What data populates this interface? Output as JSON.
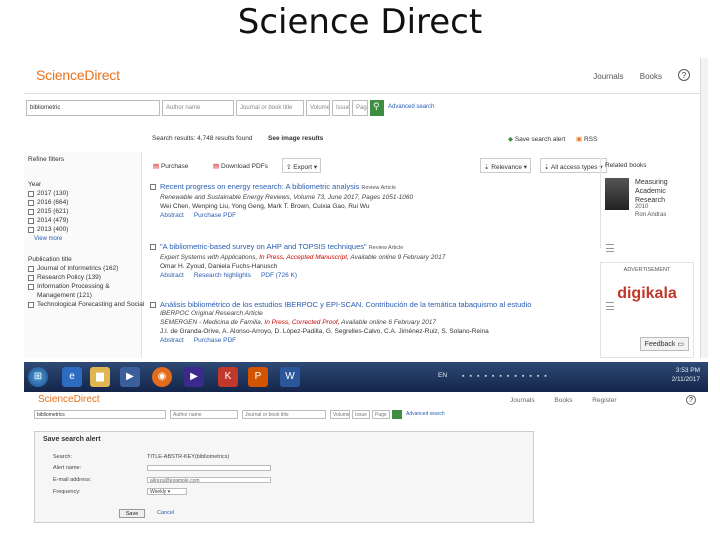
{
  "slide": {
    "title": "Science Direct"
  },
  "sd": {
    "logo": "ScienceDirect",
    "nav": {
      "journals": "Journals",
      "books": "Books",
      "help": "?"
    },
    "search": {
      "keywords": "bibliometric",
      "author": "Author name",
      "journal": "Journal or book title",
      "volume": "Volume",
      "issue": "Issue",
      "page": "Page",
      "advanced": "Advanced search"
    },
    "results_text": "Search results: 4,748 results found",
    "see_images": "See image results",
    "save_alert": "Save search alert",
    "rss": "RSS",
    "sidebar": {
      "refine": "Refine filters",
      "year_head": "Year",
      "years": [
        "2017 (130)",
        "2016 (664)",
        "2015 (621)",
        "2014 (479)",
        "2013 (400)"
      ],
      "view_more": "View more",
      "pub_head": "Publication title",
      "pubs": [
        "Journal of Informetrics (162)",
        "Research Policy (139)",
        "Information Processing &",
        "Management (121)",
        "Technological Forecasting and Social"
      ]
    },
    "toolbar": {
      "purchase": "Purchase",
      "download": "Download PDFs",
      "export": "Export",
      "relevance": "Relevance",
      "access": "All access types"
    },
    "results": [
      {
        "title": "Recent progress on energy research: A bibliometric analysis",
        "type": "Review Article",
        "journal": "Renewable and Sustainable Energy Reviews, Volume 73, June 2017, Pages 1051-1060",
        "authors": "Wei Chen, Wenping Liu, Yong Geng, Mark T. Brown, Cuixia Gao, Rui Wu",
        "links": [
          "Abstract",
          "Purchase PDF"
        ]
      },
      {
        "title": "\"A bibliometric-based survey on AHP and TOPSIS techniques\"",
        "type": "Review Article",
        "journal": "Expert Systems with Applications,",
        "status": "In Press, Accepted Manuscript,",
        "avail": "Available online 9 February 2017",
        "authors": "Omar H. Zyoud, Daniela Fuchs-Hanusch",
        "links": [
          "Abstract",
          "Research highlights",
          "PDF (726 K)"
        ]
      },
      {
        "title": "Análisis bibliométrico de los estudios IBERPOC y EPI-SCAN. Contribución de la temática tabaquismo al estudio",
        "type": "IBERPOC Original Research Article",
        "journal": "SEMERGEN - Medicina de Familia,",
        "status": "In Press, Corrected Proof,",
        "avail": "Available online 6 February 2017",
        "authors": "J.I. de Granda-Orive, A. Alonso-Arroyo, D. López-Padilla, G. Segrelles-Calvo, C.A. Jiménez-Ruiz, S. Solano-Reina",
        "links": [
          "Abstract",
          "Purchase PDF"
        ]
      }
    ],
    "related": {
      "head": "Related books",
      "book_title": "Measuring Academic Research",
      "book_year": "2010",
      "book_author": "Ron Andras"
    },
    "ad": {
      "label": "ADVERTISEMENT",
      "logo": "digikala",
      "feedback": "Feedback"
    }
  },
  "taskbar": {
    "time": "3:53 PM",
    "date": "2/11/2017",
    "lang": "EN"
  },
  "sd2": {
    "logo": "ScienceDirect",
    "nav": [
      "Journals",
      "Books",
      "Register"
    ],
    "search_value": "bibliometrics",
    "author": "Author name",
    "journal": "Journal or book title",
    "volume": "Volume",
    "issue": "Issue",
    "page": "Page",
    "advanced": "Advanced search",
    "panel_title": "Save search alert",
    "fields": {
      "search_label": "Search:",
      "search_value": "TITLE-ABSTR-KEY(bibliometrics)",
      "alert_label": "Alert name:",
      "email_label": "E-mail address:",
      "email_value": "alireza@example.com",
      "freq_label": "Frequency:",
      "freq_value": "Weekly"
    },
    "save": "Save",
    "cancel": "Cancel"
  }
}
